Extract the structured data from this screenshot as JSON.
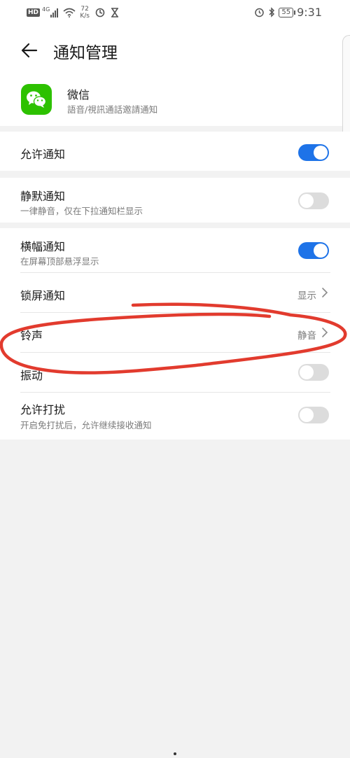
{
  "status_bar": {
    "hd": "HD",
    "network": "4G",
    "speed_value": "72",
    "speed_unit": "K/s",
    "battery": "55",
    "time": "9:31"
  },
  "header": {
    "title": "通知管理"
  },
  "app": {
    "name": "微信",
    "description": "語音/視訊通話邀請通知"
  },
  "settings": {
    "allow_notifications": {
      "label": "允许通知",
      "enabled": true
    },
    "silent_notifications": {
      "label": "静默通知",
      "description": "一律静音，仅在下拉通知栏显示",
      "enabled": false
    },
    "banner_notifications": {
      "label": "横幅通知",
      "description": "在屏幕顶部悬浮显示",
      "enabled": true
    },
    "lock_screen": {
      "label": "锁屏通知",
      "value": "显示"
    },
    "ringtone": {
      "label": "铃声",
      "value": "静音"
    },
    "vibration": {
      "label": "振动",
      "enabled": false
    },
    "do_not_disturb": {
      "label": "允许打扰",
      "description": "开启免打扰后，允许继续接收通知",
      "enabled": false
    }
  },
  "colors": {
    "toggle_on": "#1e73e8",
    "toggle_off": "#dcdcdc",
    "annotation": "#e23b2e",
    "app_icon": "#2dc100"
  }
}
